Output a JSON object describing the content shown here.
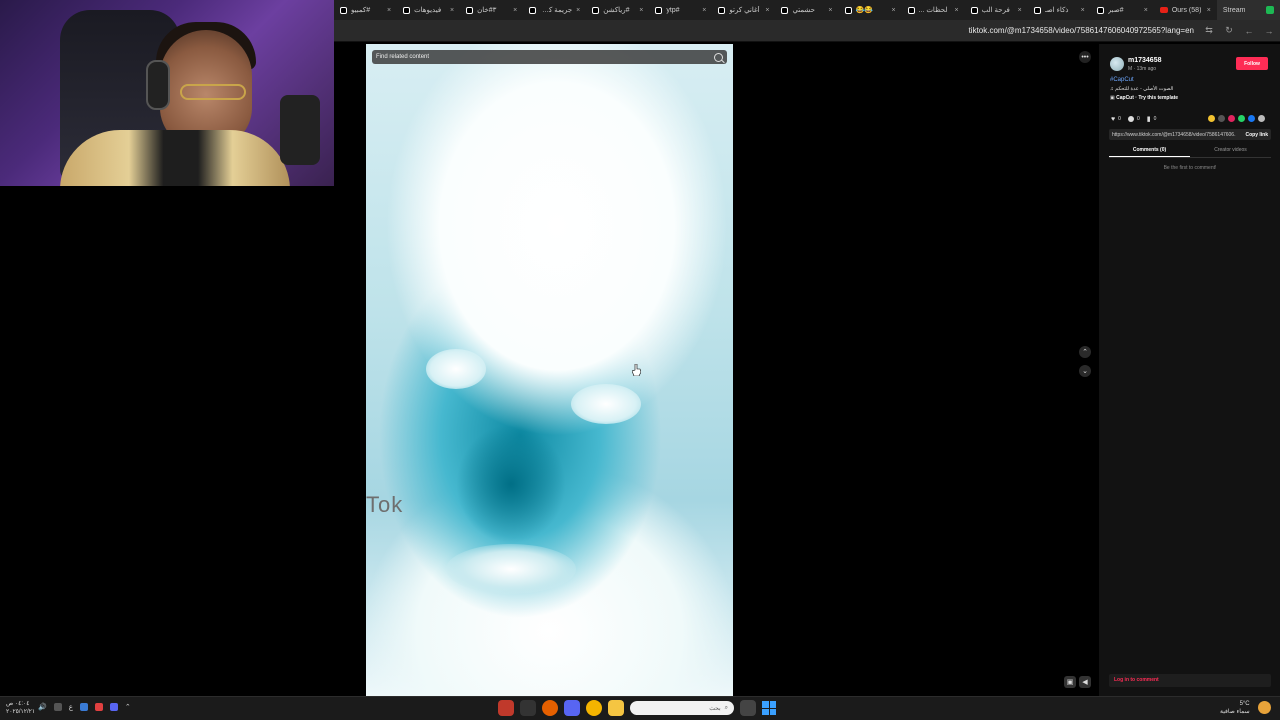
{
  "browser": {
    "tabs": [
      {
        "label": "#كمبيو"
      },
      {
        "label": "فيديوهات"
      },
      {
        "label": "٣#خان"
      },
      {
        "label": "جريمة كرتو"
      },
      {
        "label": "#رياكشن"
      },
      {
        "label": "#ytp"
      },
      {
        "label": "أغاني كرتو"
      },
      {
        "label": "حشمتي"
      },
      {
        "label": "😂😂"
      },
      {
        "label": "لحظات ..."
      },
      {
        "label": "فرحة الب"
      },
      {
        "label": "ذكاء اصـ"
      },
      {
        "label": "#صبر"
      },
      {
        "label": "(58) Ours"
      },
      {
        "label": "Stream"
      }
    ],
    "url": "tiktok.com/@m1734658/video/7586147606040972565?lang=en"
  },
  "video": {
    "search_placeholder": "Find related content",
    "overlay_text": "Tok"
  },
  "panel": {
    "username": "m1734658",
    "subline": "M · 13m ago",
    "follow_label": "Follow",
    "hashtag": "#CapCut",
    "music": "♫ الصوت الأصلي - عدة للتحكم",
    "template_prefix": "▣",
    "template_label": "CapCut · Try this template",
    "stats": {
      "likes": "0",
      "comments": "0",
      "saves": "0"
    },
    "link": "https://www.tiktok.com/@m1734658/video/7586147606...",
    "copy_label": "Copy link",
    "tab_comments": "Comments (0)",
    "tab_creator": "Creator videos",
    "empty_text": "Be the first to comment!",
    "login_label": "Log in to comment"
  },
  "taskbar": {
    "time": "٠٤:٠٤ ص",
    "date": "٢٠٢٥/١٢/٢١",
    "lang": "ع",
    "search_placeholder": "بحث",
    "temp": "5°C",
    "weather_text": "سماء صافية"
  },
  "colors": {
    "accent": "#fe2c55",
    "hashtag": "#6ea8ff"
  }
}
